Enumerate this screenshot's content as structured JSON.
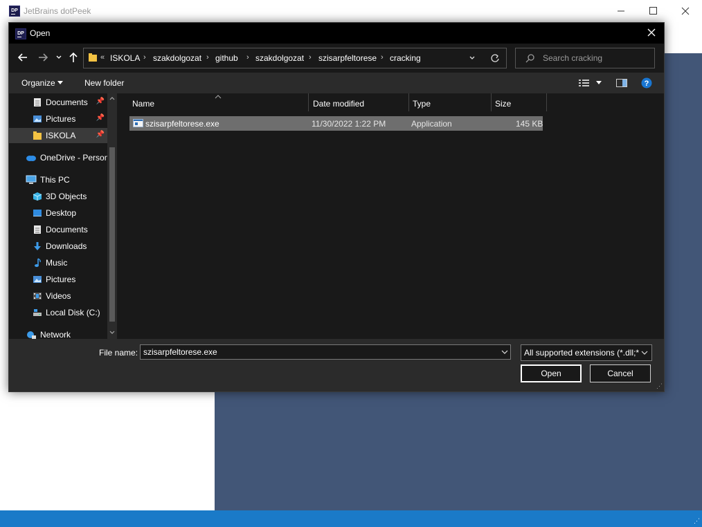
{
  "app": {
    "title": "JetBrains dotPeek",
    "icon_text": "DP"
  },
  "dialog": {
    "title": "Open"
  },
  "breadcrumb": {
    "overflow": "«",
    "items": [
      "ISKOLA",
      "szakdolgozat",
      "github",
      "szakdolgozat",
      "szisarpfeltorese",
      "cracking"
    ]
  },
  "search": {
    "placeholder": "Search cracking"
  },
  "toolbar": {
    "organize": "Organize",
    "new_folder": "New folder"
  },
  "nav": {
    "items": [
      {
        "label": "Documents",
        "icon": "documents-icon",
        "pinned": true
      },
      {
        "label": "Pictures",
        "icon": "pictures-icon",
        "pinned": true
      },
      {
        "label": "ISKOLA",
        "icon": "folder-icon",
        "pinned": true
      },
      {
        "label": "OneDrive - Person",
        "icon": "onedrive-icon"
      },
      {
        "label": "This PC",
        "icon": "this-pc-icon"
      },
      {
        "label": "3D Objects",
        "icon": "3d-objects-icon"
      },
      {
        "label": "Desktop",
        "icon": "desktop-icon"
      },
      {
        "label": "Documents",
        "icon": "documents-icon"
      },
      {
        "label": "Downloads",
        "icon": "downloads-icon"
      },
      {
        "label": "Music",
        "icon": "music-icon"
      },
      {
        "label": "Pictures",
        "icon": "pictures-icon"
      },
      {
        "label": "Videos",
        "icon": "videos-icon"
      },
      {
        "label": "Local Disk (C:)",
        "icon": "local-disk-icon"
      },
      {
        "label": "Network",
        "icon": "network-icon"
      }
    ]
  },
  "columns": {
    "name": "Name",
    "date": "Date modified",
    "type": "Type",
    "size": "Size"
  },
  "files": [
    {
      "name": "szisarpfeltorese.exe",
      "date": "11/30/2022 1:22 PM",
      "type": "Application",
      "size": "145 KB"
    }
  ],
  "footer": {
    "file_name_label": "File name:",
    "file_name_value": "szisarpfeltorese.exe",
    "filter": "All supported extensions (*.dll;*",
    "open": "Open",
    "cancel": "Cancel"
  },
  "colors": {
    "dialog_bg": "#191919",
    "toolbar_bg": "#2b2b2b",
    "app_content_bg": "#425677",
    "statusbar_bg": "#1a7ac8",
    "selected_row": "#6e6e6e"
  }
}
